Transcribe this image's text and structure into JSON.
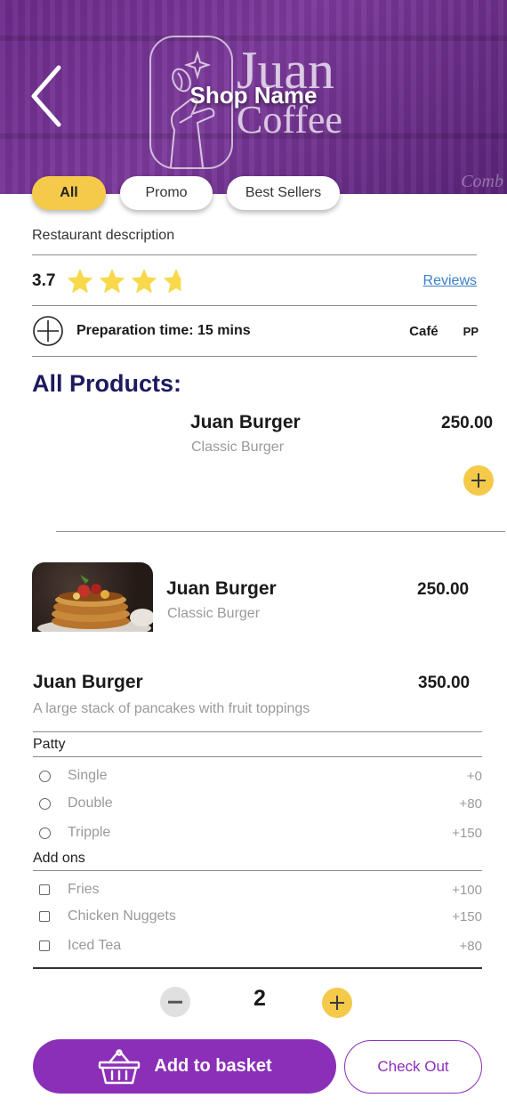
{
  "header": {
    "shop_name": "Shop Name",
    "logo_line1": "Juan",
    "logo_line2": "Coffee",
    "sign_text": "Comb"
  },
  "tabs": [
    {
      "label": "All",
      "active": true
    },
    {
      "label": "Promo",
      "active": false
    },
    {
      "label": "Best Sellers",
      "active": false
    }
  ],
  "restaurant": {
    "description": "Restaurant description",
    "rating": "3.7",
    "rating_value": 3.7,
    "reviews_link": "Reviews",
    "prep_time": "Preparation time: 15 mins",
    "category": "Café",
    "price_range": "PP"
  },
  "section_title": "All Products:",
  "products": [
    {
      "name": "Juan Burger",
      "subtitle": "Classic Burger",
      "price": "250.00"
    },
    {
      "name": "Juan Burger",
      "subtitle": "Classic Burger",
      "price": "250.00"
    }
  ],
  "detail": {
    "name": "Juan Burger",
    "price": "350.00",
    "description": "A large stack of pancakes with fruit toppings",
    "patty": {
      "title": "Patty",
      "options": [
        {
          "label": "Single",
          "price": "+0"
        },
        {
          "label": "Double",
          "price": "+80"
        },
        {
          "label": "Tripple",
          "price": "+150"
        }
      ]
    },
    "addons": {
      "title": "Add ons",
      "options": [
        {
          "label": "Fries",
          "price": "+100"
        },
        {
          "label": "Chicken Nuggets",
          "price": "+150"
        },
        {
          "label": "Iced Tea",
          "price": "+80"
        }
      ]
    },
    "quantity": "2"
  },
  "actions": {
    "add_to_basket": "Add to basket",
    "checkout": "Check Out"
  },
  "colors": {
    "brand_purple": "#8b2fb8",
    "accent_yellow": "#f5c94a",
    "title_navy": "#1c1a5e",
    "link_blue": "#3c7fc7"
  }
}
